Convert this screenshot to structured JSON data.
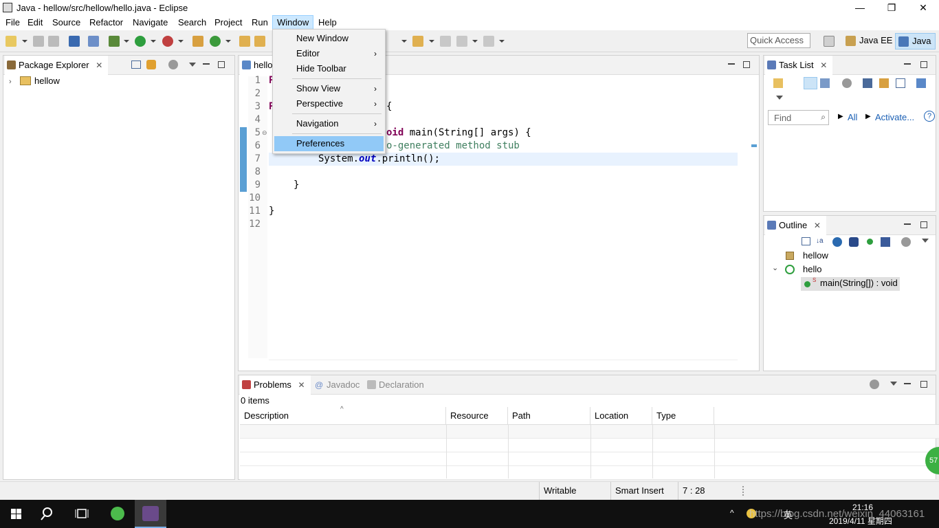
{
  "window": {
    "title": "Java - hellow/src/hellow/hello.java - Eclipse",
    "minimize": "—",
    "restore": "❐",
    "close": "✕"
  },
  "menubar": [
    "File",
    "Edit",
    "Source",
    "Refactor",
    "Navigate",
    "Search",
    "Project",
    "Run",
    "Window",
    "Help"
  ],
  "toolbar": {
    "quick_access_placeholder": "Quick Access",
    "perspectives": [
      "Java EE",
      "Java"
    ]
  },
  "package_explorer": {
    "tab": "Package Explorer",
    "tree": [
      {
        "label": "hellow",
        "icon": "project-folder-icon",
        "expanded": false
      }
    ]
  },
  "editor": {
    "tab": "hello",
    "lines": [
      {
        "num": "1",
        "text": ""
      },
      {
        "num": "2",
        "text": ""
      },
      {
        "num": "3",
        "text": "{"
      },
      {
        "num": "4",
        "text": ""
      },
      {
        "num": "5",
        "text": "oid main(String[] args) {"
      },
      {
        "num": "6",
        "text": "o-generated method stub"
      },
      {
        "num": "7",
        "text": "System.out.println();"
      },
      {
        "num": "8",
        "text": ""
      },
      {
        "num": "9",
        "text": "}"
      },
      {
        "num": "10",
        "text": ""
      },
      {
        "num": "11",
        "text": "}"
      },
      {
        "num": "12",
        "text": ""
      }
    ],
    "code_parts": {
      "l5_kw": "oid",
      "l5_rest": " main(String[] args) {",
      "l6": "o-generated method stub",
      "l7_a": "System.",
      "l7_b": "out",
      "l7_c": ".println();",
      "l3": "{",
      "l9": "}",
      "l11": "}",
      "frag_char": "P"
    }
  },
  "window_menu": {
    "items": [
      {
        "label": "New Window",
        "submenu": false
      },
      {
        "label": "Editor",
        "submenu": true
      },
      {
        "label": "Hide Toolbar",
        "submenu": false
      },
      {
        "label": "Show View",
        "submenu": true
      },
      {
        "label": "Perspective",
        "submenu": true
      },
      {
        "label": "Navigation",
        "submenu": true
      },
      {
        "label": "Preferences",
        "submenu": false,
        "highlighted": true
      }
    ],
    "arrow": "›"
  },
  "task_list": {
    "tab": "Task List",
    "find_placeholder": "Find",
    "all": "All",
    "activate": "Activate...",
    "help": "?"
  },
  "outline": {
    "tab": "Outline",
    "items": [
      {
        "label": "hellow",
        "icon": "package-icon"
      },
      {
        "label": "hello",
        "icon": "class-icon",
        "expanded": true
      },
      {
        "label": "main(String[]) : void",
        "icon": "method-icon",
        "selected": true
      }
    ],
    "static_marker": "S"
  },
  "problems": {
    "tabs": [
      "Problems",
      "Javadoc",
      "Declaration"
    ],
    "count": "0 items",
    "columns": [
      "Description",
      "Resource",
      "Path",
      "Location",
      "Type"
    ]
  },
  "statusbar": {
    "writable": "Writable",
    "insert_mode": "Smart Insert",
    "position": "7 : 28"
  },
  "taskbar": {
    "time": "21:16",
    "date": "2019/4/11 星期四",
    "ime": "英",
    "watermark": "https://blog.csdn.net/weixin_44063161",
    "badge": "57"
  },
  "colors": {
    "accent": "#91c9f7",
    "menu_open": "#cce8ff",
    "keyword": "#7f0055",
    "comment": "#3f7f5f",
    "field": "#0000c0"
  }
}
